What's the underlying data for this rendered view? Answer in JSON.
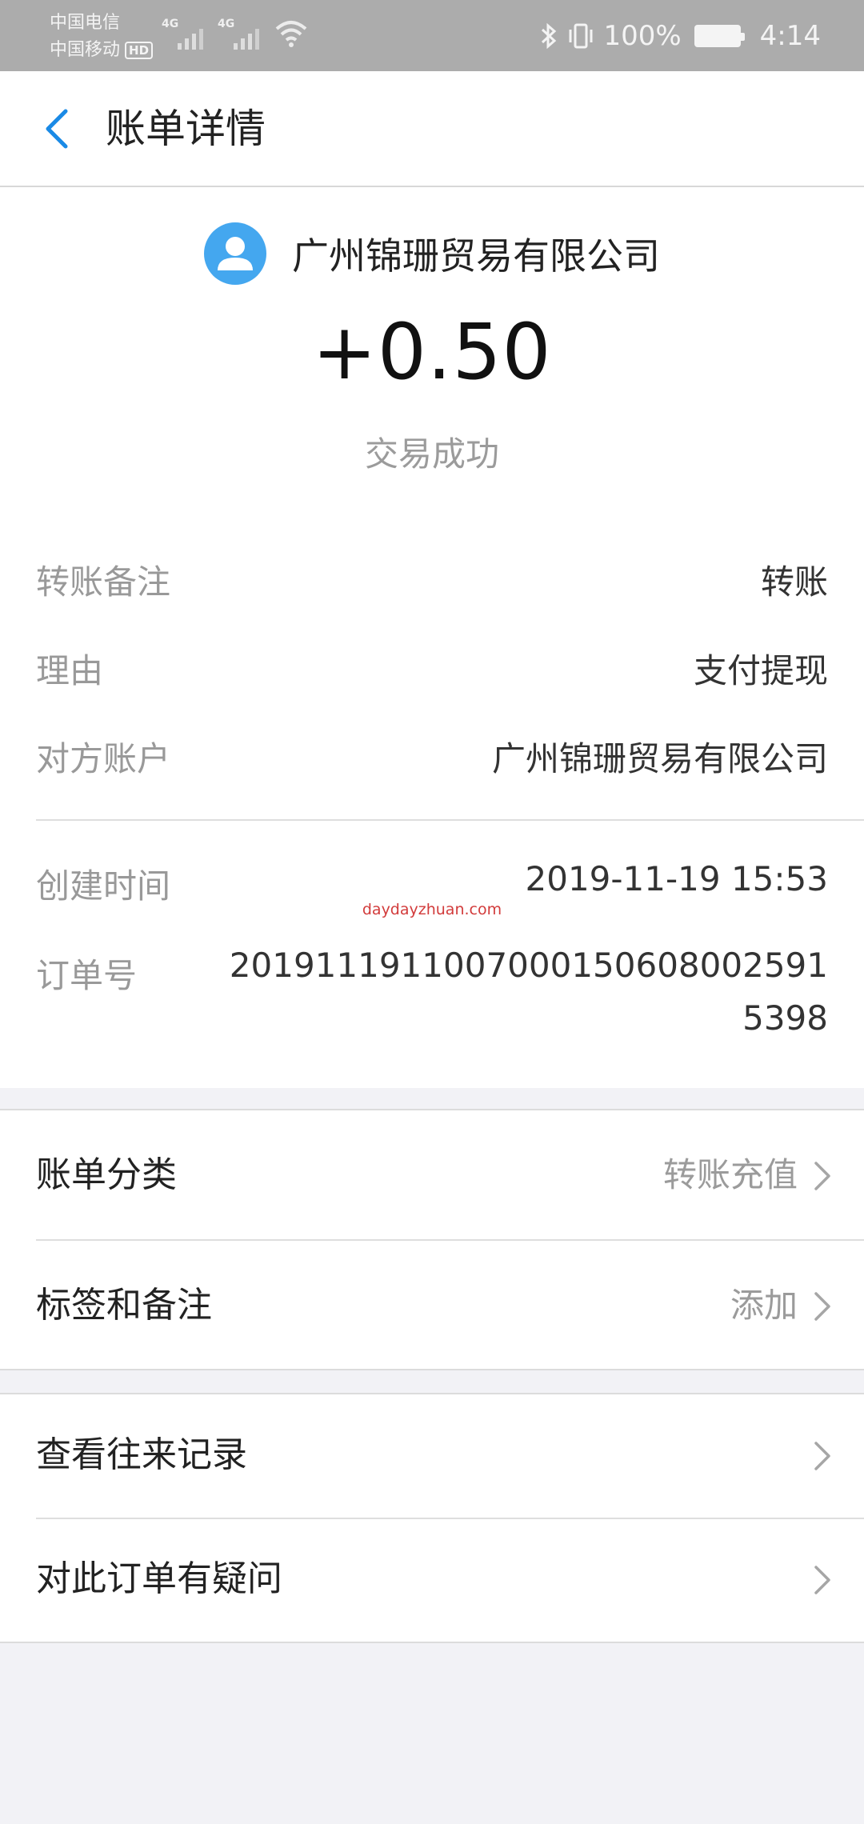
{
  "status_bar": {
    "carrier_1": "中国电信",
    "carrier_2": "中国移动",
    "hd_badge": "HD",
    "network_1": "4G",
    "network_2": "4G",
    "battery_percent": "100%",
    "time": "4:14"
  },
  "header": {
    "title": "账单详情"
  },
  "transaction": {
    "payee_name": "广州锦珊贸易有限公司",
    "amount": "+0.50",
    "status": "交易成功"
  },
  "details": {
    "remark_label": "转账备注",
    "remark_value": "转账",
    "reason_label": "理由",
    "reason_value": "支付提现",
    "account_label": "对方账户",
    "account_value": "广州锦珊贸易有限公司",
    "time_label": "创建时间",
    "time_value": "2019-11-19 15:53",
    "order_label": "订单号",
    "order_value": "2019111911007000150608002591 5398"
  },
  "watermark": "daydayzhuan.com",
  "options": {
    "category_label": "账单分类",
    "category_value": "转账充值",
    "tags_label": "标签和备注",
    "tags_value": "添加",
    "history_label": "查看往来记录",
    "question_label": "对此订单有疑问"
  },
  "colors": {
    "accent": "#1a8ae6",
    "avatar": "#44a7ef",
    "watermark": "#d23b3b"
  }
}
